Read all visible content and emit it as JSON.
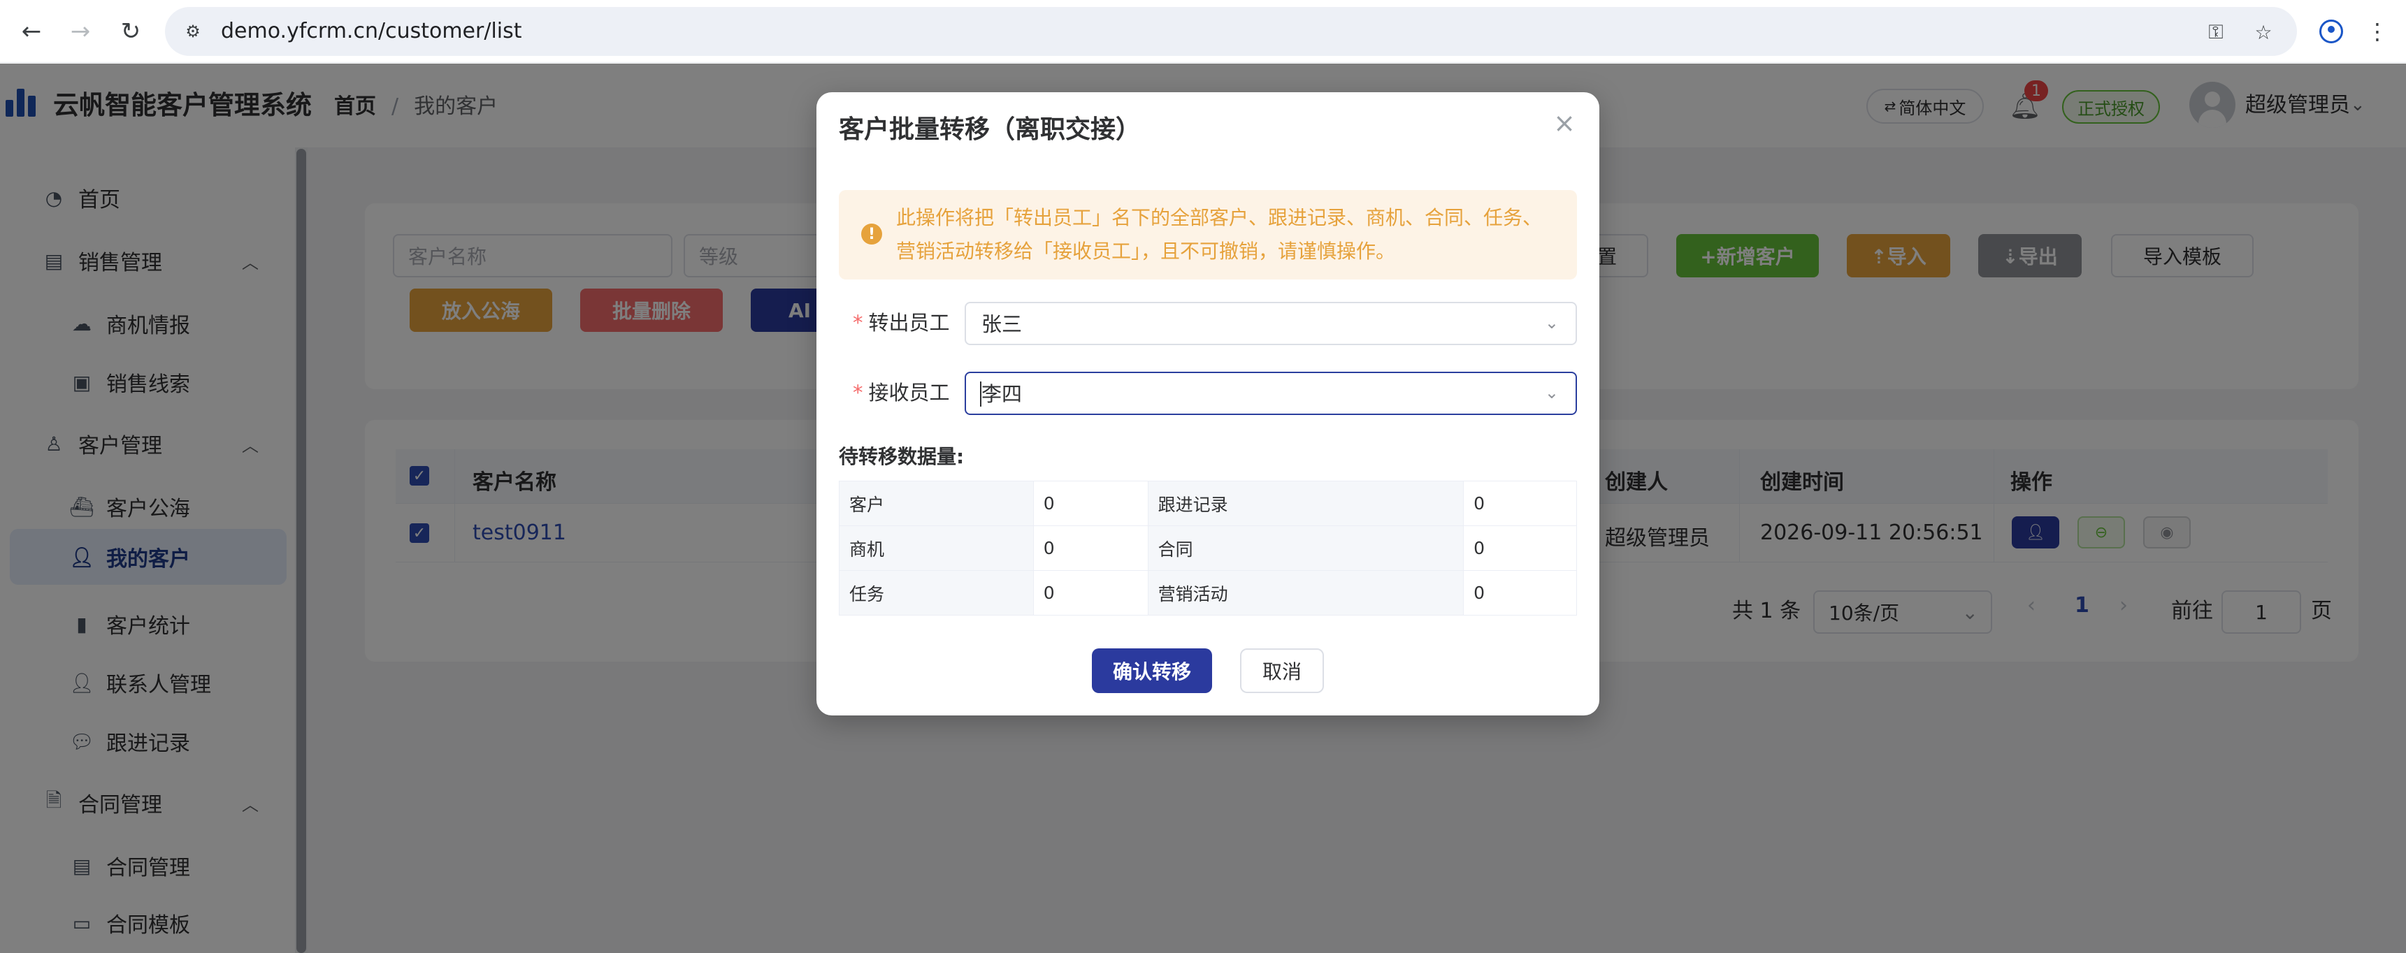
{
  "browser": {
    "url": "demo.yfcrm.cn/customer/list"
  },
  "app": {
    "title": "云帆智能客户管理系统",
    "breadcrumb": {
      "home": "首页",
      "separator": "/",
      "current": "我的客户"
    },
    "lang_button": "简体中文",
    "notification_count": "1",
    "license_tag": "正式授权",
    "user_name": "超级管理员"
  },
  "sidebar": {
    "items": [
      {
        "label": "首页",
        "icon": "dashboard-icon"
      },
      {
        "label": "销售管理",
        "icon": "chart-icon"
      },
      {
        "label": "商机情报",
        "icon": "cloud-icon"
      },
      {
        "label": "销售线索",
        "icon": "lead-icon"
      },
      {
        "label": "客户管理",
        "icon": "user-icon"
      },
      {
        "label": "客户公海",
        "icon": "ship-icon"
      },
      {
        "label": "我的客户",
        "icon": "user-icon"
      },
      {
        "label": "客户统计",
        "icon": "bar-chart-icon"
      },
      {
        "label": "联系人管理",
        "icon": "contact-icon"
      },
      {
        "label": "跟进记录",
        "icon": "chat-icon"
      },
      {
        "label": "合同管理",
        "icon": "document-icon"
      },
      {
        "label": "合同管理",
        "icon": "document-icon"
      },
      {
        "label": "合同模板",
        "icon": "template-icon"
      }
    ]
  },
  "filters": {
    "customer_name_placeholder": "客户名称",
    "level_placeholder": "等级",
    "reset_partial": "置",
    "add_customer": "+新增客户",
    "import": "⇡导入",
    "export": "⇣导出",
    "import_template": "导入模板",
    "to_pool": "放入公海",
    "batch_delete": "批量删除",
    "ai_partial": "AI"
  },
  "table": {
    "headers": {
      "name": "客户名称",
      "creator": "创建人",
      "created_at": "创建时间",
      "actions": "操作"
    },
    "rows": [
      {
        "name": "test0911",
        "creator": "超级管理员",
        "created_at": "2026-09-11 20:56:51"
      }
    ]
  },
  "pagination": {
    "total": "共 1 条",
    "page_size": "10条/页",
    "current_page": "1",
    "goto_label": "前往",
    "goto_value": "1",
    "page_suffix": "页"
  },
  "dialog": {
    "title": "客户批量转移（离职交接）",
    "warning_line1": "此操作将把「转出员工」名下的全部客户、跟进记录、商机、合同、任务、",
    "warning_line2": "营销活动转移给「接收员工」，且不可撤销，请谨慎操作。",
    "from_label": "转出员工",
    "from_value": "张三",
    "to_label": "接收员工",
    "to_value": "李四",
    "count_title": "待转移数据量:",
    "counts": [
      {
        "label": "客户",
        "value": "0",
        "label2": "跟进记录",
        "value2": "0"
      },
      {
        "label": "商机",
        "value": "0",
        "label2": "合同",
        "value2": "0"
      },
      {
        "label": "任务",
        "value": "0",
        "label2": "营销活动",
        "value2": "0"
      }
    ],
    "confirm": "确认转移",
    "cancel": "取消"
  },
  "colors": {
    "primary": "#2b3a9e",
    "success": "#67c23a",
    "warning": "#e6a23c",
    "danger": "#f56c6c",
    "info": "#909399"
  }
}
